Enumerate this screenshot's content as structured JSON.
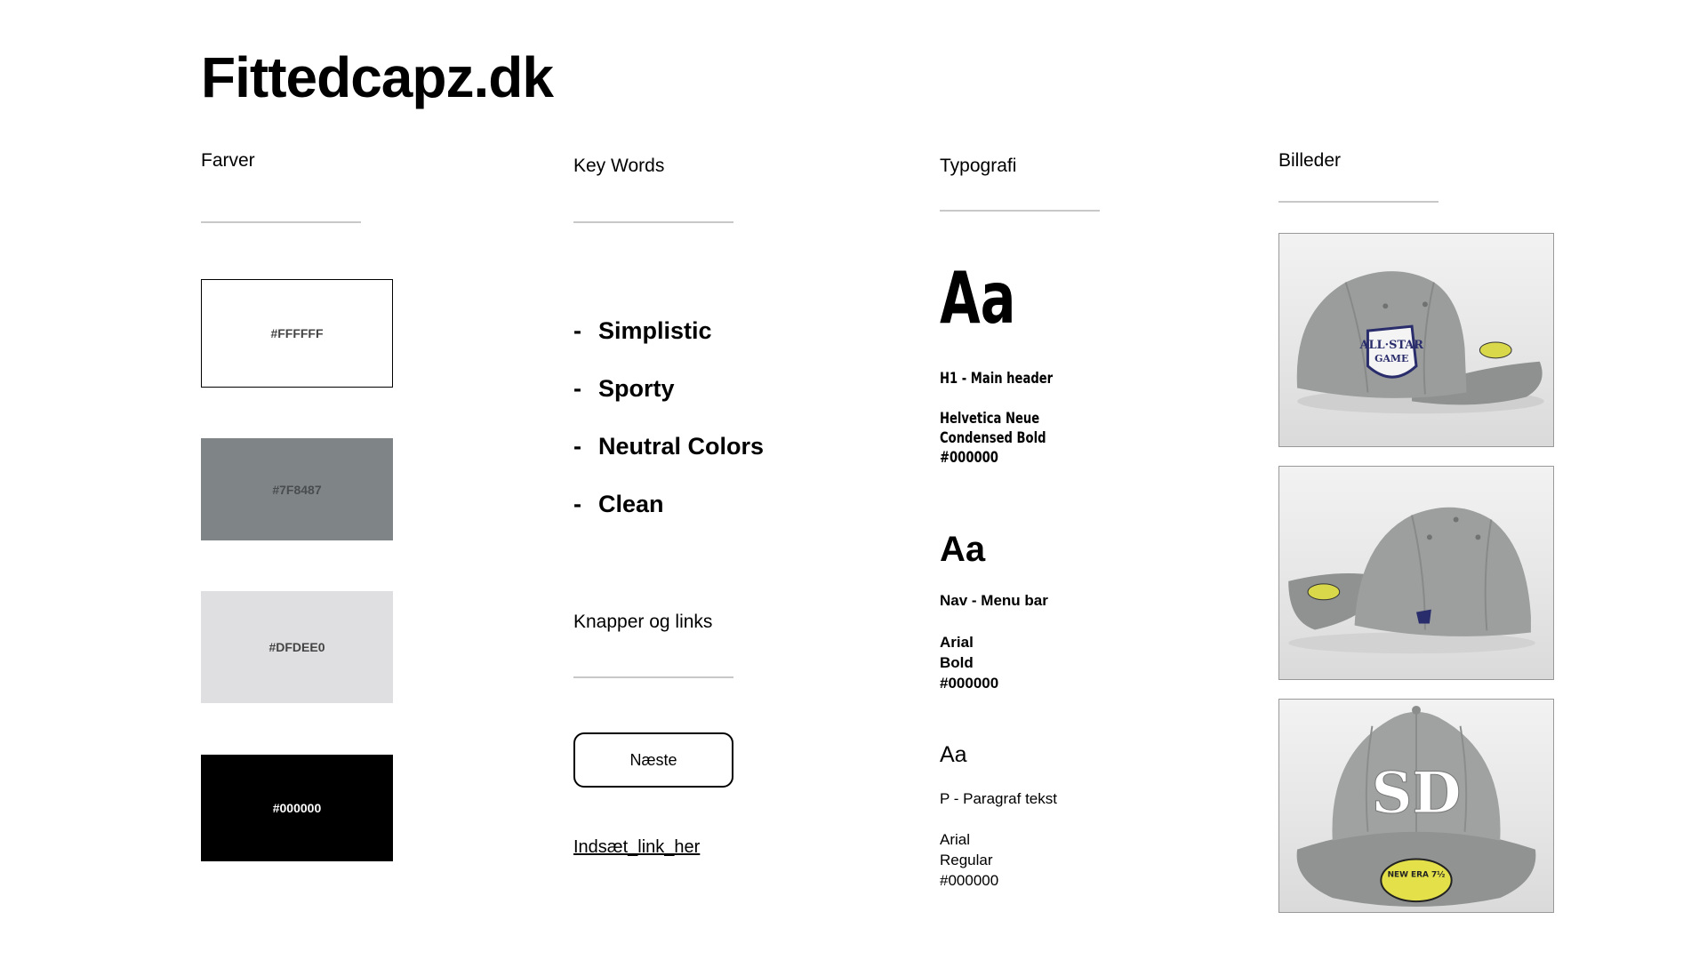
{
  "title": "Fittedcapz.dk",
  "colors": {
    "heading": "Farver",
    "swatches": [
      {
        "label": "#FFFFFF",
        "hex": "#FFFFFF"
      },
      {
        "label": "#7F8487",
        "hex": "#7F8487"
      },
      {
        "label": "#DFDEE0",
        "hex": "#DFDEE0"
      },
      {
        "label": "#000000",
        "hex": "#000000"
      }
    ]
  },
  "keywords": {
    "heading": "Key Words",
    "items": [
      "Simplistic",
      "Sporty",
      "Neutral Colors",
      "Clean"
    ],
    "dash": "-"
  },
  "buttons": {
    "heading": "Knapper og links",
    "button_label": "Næste",
    "link_label": "Indsæt_link_her"
  },
  "typography": {
    "heading": "Typografi",
    "samples": [
      {
        "glyph": "Aa",
        "role": "H1 - Main header",
        "line1": "Helvetica Neue",
        "line2": "Condensed Bold",
        "color": "#000000"
      },
      {
        "glyph": "Aa",
        "role": "Nav - Menu bar",
        "line1": "Arial",
        "line2": "Bold",
        "color": "#000000"
      },
      {
        "glyph": "Aa",
        "role": "P - Paragraf tekst",
        "line1": "Arial",
        "line2": "Regular",
        "color": "#000000"
      }
    ]
  },
  "images": {
    "heading": "Billeder",
    "photos": [
      "cap-side-all-star-patch",
      "cap-side-new-era-logo",
      "cap-front-sd-logo"
    ],
    "front_logo_text": "SD",
    "sticker_text": "NEW ERA 7½"
  }
}
